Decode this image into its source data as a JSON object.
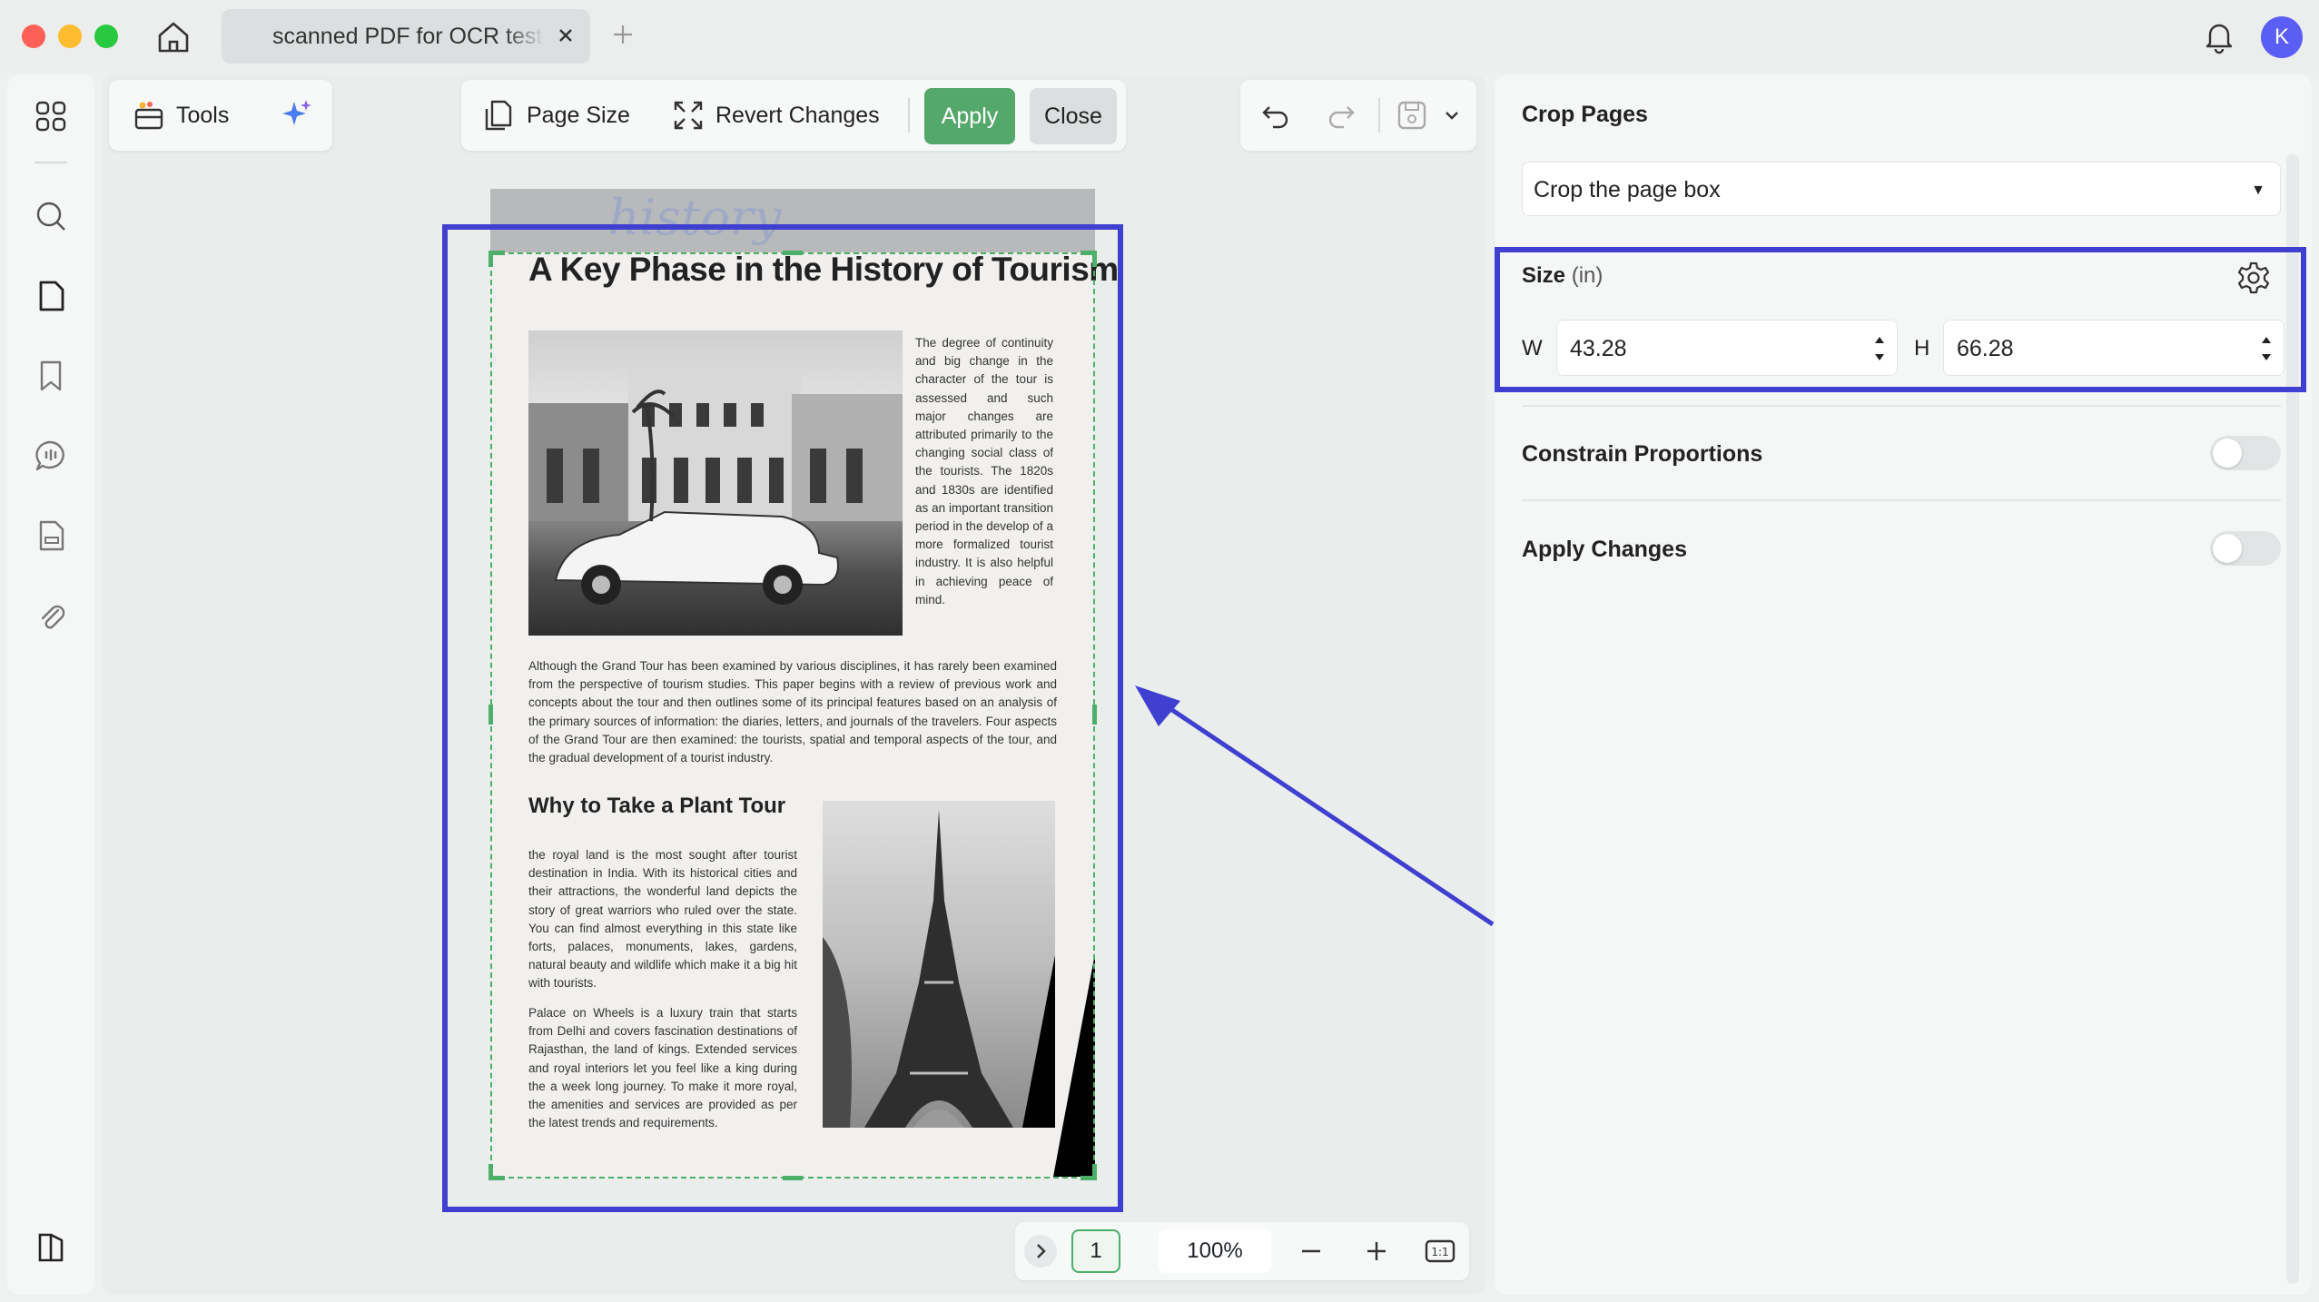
{
  "tab": {
    "title": "scanned PDF for OCR test"
  },
  "user": {
    "initial": "K"
  },
  "toolbar": {
    "tools_label": "Tools",
    "page_size_label": "Page Size",
    "revert_label": "Revert Changes",
    "apply_label": "Apply",
    "close_label": "Close"
  },
  "document": {
    "handwriting": "history",
    "title": "A Key Phase in the History of Tourism",
    "para1": "The degree of continuity and big change in the character of the tour is assessed and such major changes are attributed primarily to the changing social class of the tourists. The 1820s and 1830s are identified as an important transition period in the develop of a more formalized tourist industry. It is also helpful in achieving peace of mind.",
    "para2": "Although the Grand Tour has been examined by various disciplines, it has rarely been examined from the perspective of tourism studies. This paper begins with a review of previous work and concepts about the tour and then outlines some of its principal features based on an analysis of the primary sources of information: the diaries, letters, and journals of the travelers. Four aspects of the Grand Tour are then examined: the tourists, spatial and temporal aspects of the tour, and the gradual development of a tourist industry.",
    "subtitle": "Why to Take a Plant Tour",
    "para3": "the royal land is the most sought after tourist destination in India. With its historical cities and their attractions, the wonderful land depicts the story of great warriors who ruled over the state. You can find almost everything in this state like forts, palaces, monuments, lakes, gardens, natural beauty and wildlife which make it a big hit with tourists.",
    "para4": "Palace on Wheels is a luxury train that starts from Delhi and covers fascination destinations of Rajasthan, the land of kings. Extended services and royal interiors let you feel like a king during the a week long journey. To make it more royal, the amenities and services are provided as per the latest trends and requirements."
  },
  "pager": {
    "page": "1",
    "zoom": "100%"
  },
  "panel": {
    "title": "Crop Pages",
    "crop_mode": "Crop the page box",
    "size_label": "Size",
    "size_unit": "(in)",
    "width_label": "W",
    "width_value": "43.28",
    "height_label": "H",
    "height_value": "66.28",
    "constrain_label": "Constrain Proportions",
    "constrain_on": false,
    "apply_changes_label": "Apply Changes",
    "apply_changes_on": false
  },
  "colors": {
    "accent_green": "#55a86b",
    "highlight": "#3f3fd0",
    "avatar": "#5b5ef5"
  }
}
